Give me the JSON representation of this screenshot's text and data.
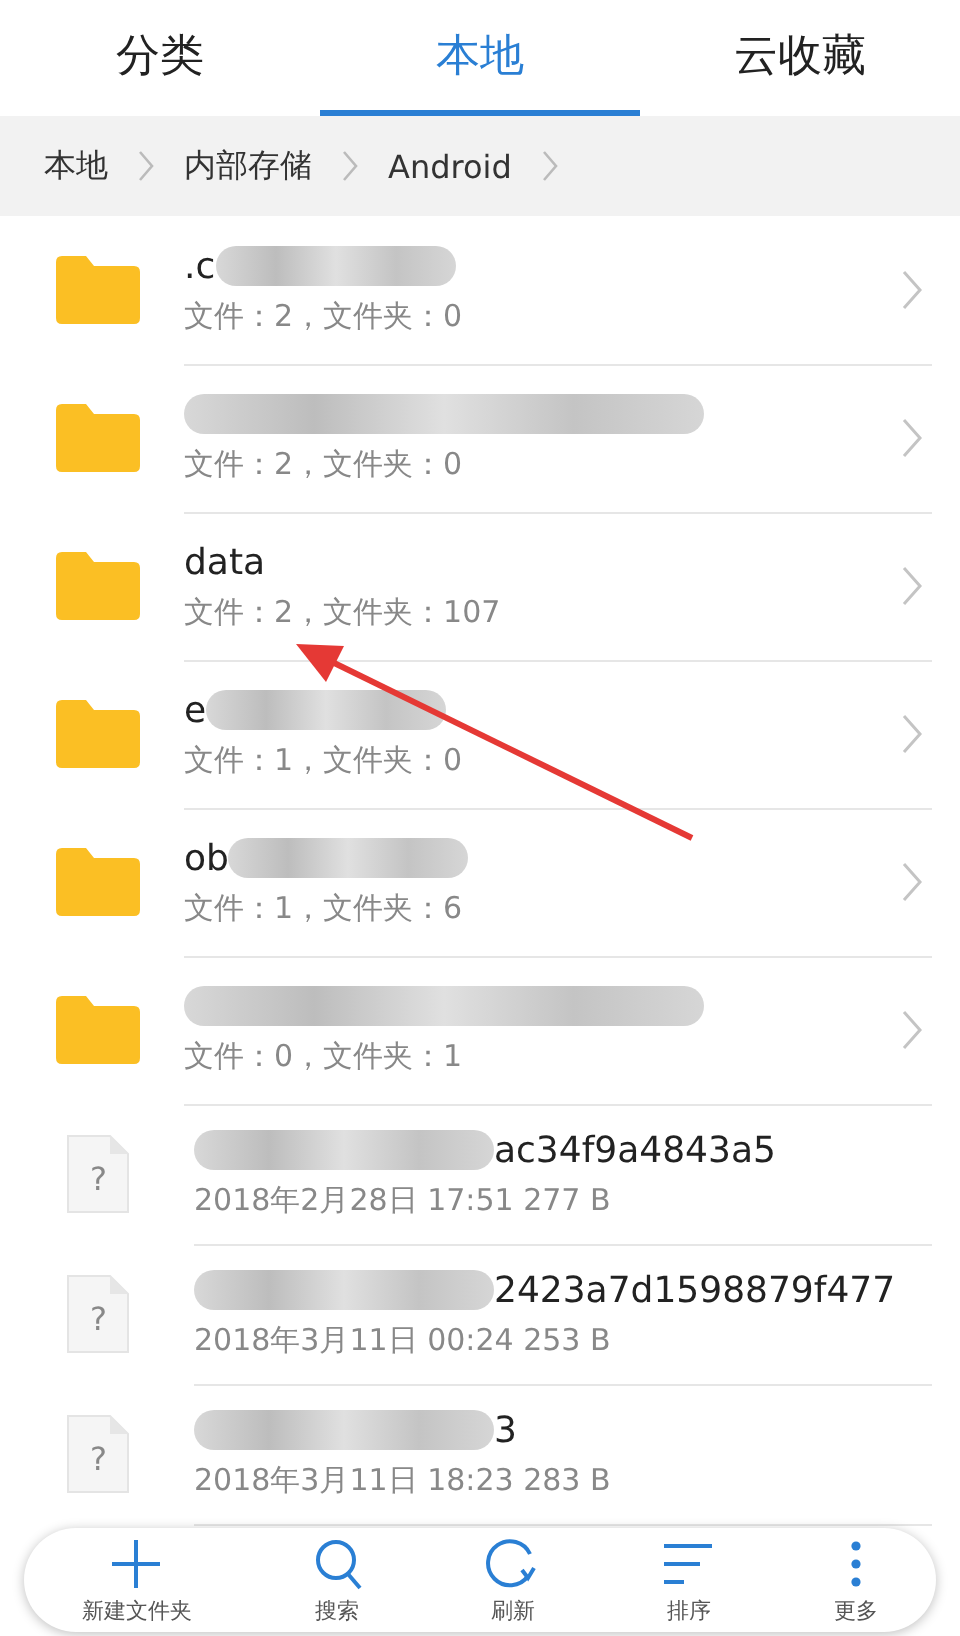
{
  "tabs": [
    {
      "label": "分类",
      "selected": false
    },
    {
      "label": "本地",
      "selected": true
    },
    {
      "label": "云收藏",
      "selected": false
    }
  ],
  "breadcrumb": [
    "本地",
    "内部存储",
    "Android"
  ],
  "items": [
    {
      "kind": "folder",
      "name": ".c",
      "blurred_after": true,
      "detail": "文件：2，文件夹：0"
    },
    {
      "kind": "folder",
      "blurred_before": true,
      "detail": "文件：2，文件夹：0"
    },
    {
      "kind": "folder",
      "name": "data",
      "detail": "文件：2，文件夹：107"
    },
    {
      "kind": "folder",
      "name": "e",
      "blurred_after": true,
      "detail": "文件：1，文件夹：0"
    },
    {
      "kind": "folder",
      "name": "ob",
      "blurred_after": true,
      "detail": "文件：1，文件夹：6"
    },
    {
      "kind": "folder",
      "blurred_before": true,
      "detail": "文件：0，文件夹：1"
    },
    {
      "kind": "file",
      "icon_text": "?",
      "name": "ac34f9a4843a5",
      "blurred_before": true,
      "detail": "2018年2月28日 17:51 277 B"
    },
    {
      "kind": "file",
      "icon_text": "?",
      "name": "2423a7d1598879f477",
      "blurred_before": true,
      "detail": "2018年3月11日 00:24 253 B"
    },
    {
      "kind": "file",
      "icon_text": "?",
      "name": "3",
      "blurred_before": true,
      "detail": "2018年3月11日 18:23 283 B"
    }
  ],
  "toolbar": [
    {
      "kind": "add",
      "label": "新建文件夹"
    },
    {
      "kind": "search",
      "label": "搜索"
    },
    {
      "kind": "refresh",
      "label": "刷新"
    },
    {
      "kind": "sort",
      "label": "排序"
    },
    {
      "kind": "more",
      "label": "更多"
    }
  ]
}
